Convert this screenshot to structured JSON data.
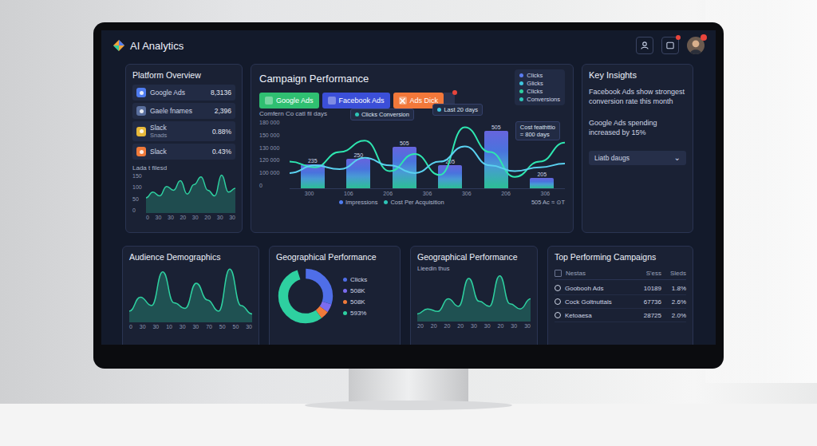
{
  "app": {
    "title": "AI Analytics"
  },
  "platform_overview": {
    "title": "Platform Overview",
    "items": [
      {
        "name": "Google Ads",
        "sub": "",
        "value": "8,3136",
        "color": "#4f7cf0"
      },
      {
        "name": "Gaele fnames",
        "sub": "",
        "value": "2,396",
        "color": "#5a6f9e"
      },
      {
        "name": "Slack",
        "sub": "Snads",
        "value": "0.88%",
        "color": "#e8b93a"
      },
      {
        "name": "Slack",
        "sub": "",
        "value": "0.43%",
        "color": "#f07a3a"
      }
    ],
    "chart_title": "Lada t filesd",
    "y_ticks": [
      "150",
      "100",
      "50",
      "0"
    ],
    "x_ticks": [
      "0",
      "30",
      "30",
      "20",
      "30",
      "20",
      "30",
      "30"
    ],
    "values": [
      40,
      55,
      45,
      70,
      60,
      85,
      50,
      75,
      95,
      60,
      45,
      100,
      55,
      65
    ]
  },
  "campaign": {
    "title": "Campaign Performance",
    "platform_buttons": [
      {
        "label": "Google Ads",
        "color": "#2fbf71"
      },
      {
        "label": "Facebook Ads",
        "color": "#3b4fd8"
      },
      {
        "label": "Ads Dick",
        "color": "#f2783a"
      }
    ],
    "legend": [
      {
        "label": "Clicks",
        "color": "#5a7cf0"
      },
      {
        "label": "Glicks",
        "color": "#3fc6e0"
      },
      {
        "label": "Clicks",
        "color": "#2ed0a0"
      },
      {
        "label": "Conversions",
        "color": "#2ec4b6"
      }
    ],
    "subtitle": "Comfern Co catl fil days",
    "tooltips": [
      "Clicks Conversion",
      "Last 20 days"
    ],
    "cpa_tip": {
      "title": "Cost feathttio",
      "value": "= 800 days"
    },
    "y_ticks": [
      "180 000",
      "150 000",
      "130 000",
      "120 000",
      "100 000",
      "0"
    ],
    "y_max": 180000,
    "bars": [
      {
        "value": 63000,
        "label": "235"
      },
      {
        "value": 78000,
        "label": "250"
      },
      {
        "value": 108000,
        "label": "505"
      },
      {
        "value": 60000,
        "label": "205"
      },
      {
        "value": 150000,
        "label": "505"
      },
      {
        "value": 27000,
        "label": "205"
      }
    ],
    "series": [
      {
        "color": "#2ee6b0",
        "values": [
          70000,
          55000,
          95000,
          125000,
          45000,
          90000,
          35000,
          160000,
          95000,
          30000,
          70000,
          120000
        ]
      },
      {
        "color": "#5ad1f0",
        "values": [
          40000,
          60000,
          50000,
          80000,
          60000,
          40000,
          70000,
          110000,
          60000,
          45000,
          55000,
          65000
        ]
      }
    ],
    "x_ticks": [
      "300",
      "106",
      "206",
      "306",
      "306",
      "206",
      "306"
    ],
    "footer_legend": [
      {
        "label": "Impressions",
        "color": "#4f7cf0"
      },
      {
        "label": "Cost Per Acquisition",
        "color": "#2ec4b6"
      }
    ],
    "footer_note": "505 Ac ≈ ⊙T"
  },
  "key_insights": {
    "title": "Key Insights",
    "insights": [
      "Facebook Ads show strongest conversion rate this month",
      "Google Ads spending increased by 15%"
    ],
    "dropdown": {
      "label": "Liatb daugs",
      "arrow": "⌄"
    }
  },
  "audience": {
    "title": "Audience Demographics",
    "values": [
      20,
      45,
      30,
      90,
      35,
      25,
      70,
      40,
      20,
      95,
      30,
      15
    ],
    "x_ticks": [
      "0",
      "30",
      "30",
      "10",
      "30",
      "30",
      "70",
      "50",
      "50",
      "30"
    ]
  },
  "geo_donut": {
    "title": "Geographical Performance",
    "legend": [
      {
        "label": "Clicks",
        "color": "#4f6ee8",
        "share": 0.3
      },
      {
        "label": "508K",
        "color": "#7b6cf0",
        "share": 0.05
      },
      {
        "label": "508K",
        "color": "#f07a3a",
        "share": 0.05
      },
      {
        "label": "593%",
        "color": "#2ed0a0",
        "share": 0.55
      }
    ]
  },
  "geo_area": {
    "title": "Geographical Performance",
    "subtitle": "Lieedin thus",
    "values": [
      15,
      25,
      20,
      45,
      30,
      85,
      40,
      30,
      90,
      35,
      25,
      45
    ],
    "x_ticks": [
      "20",
      "20",
      "20",
      "20",
      "30",
      "30",
      "20",
      "30",
      "30"
    ]
  },
  "top_campaigns": {
    "title": "Top Performing Campaigns",
    "columns": [
      "Nestas",
      "S'ess",
      "Sleds"
    ],
    "rows": [
      {
        "name": "Goobooh Ads",
        "value": "10189",
        "rate": "1.8%"
      },
      {
        "name": "Cock Goltnuttals",
        "value": "67736",
        "rate": "2.6%"
      },
      {
        "name": "Ketoaesa",
        "value": "28725",
        "rate": "2.0%"
      }
    ]
  }
}
